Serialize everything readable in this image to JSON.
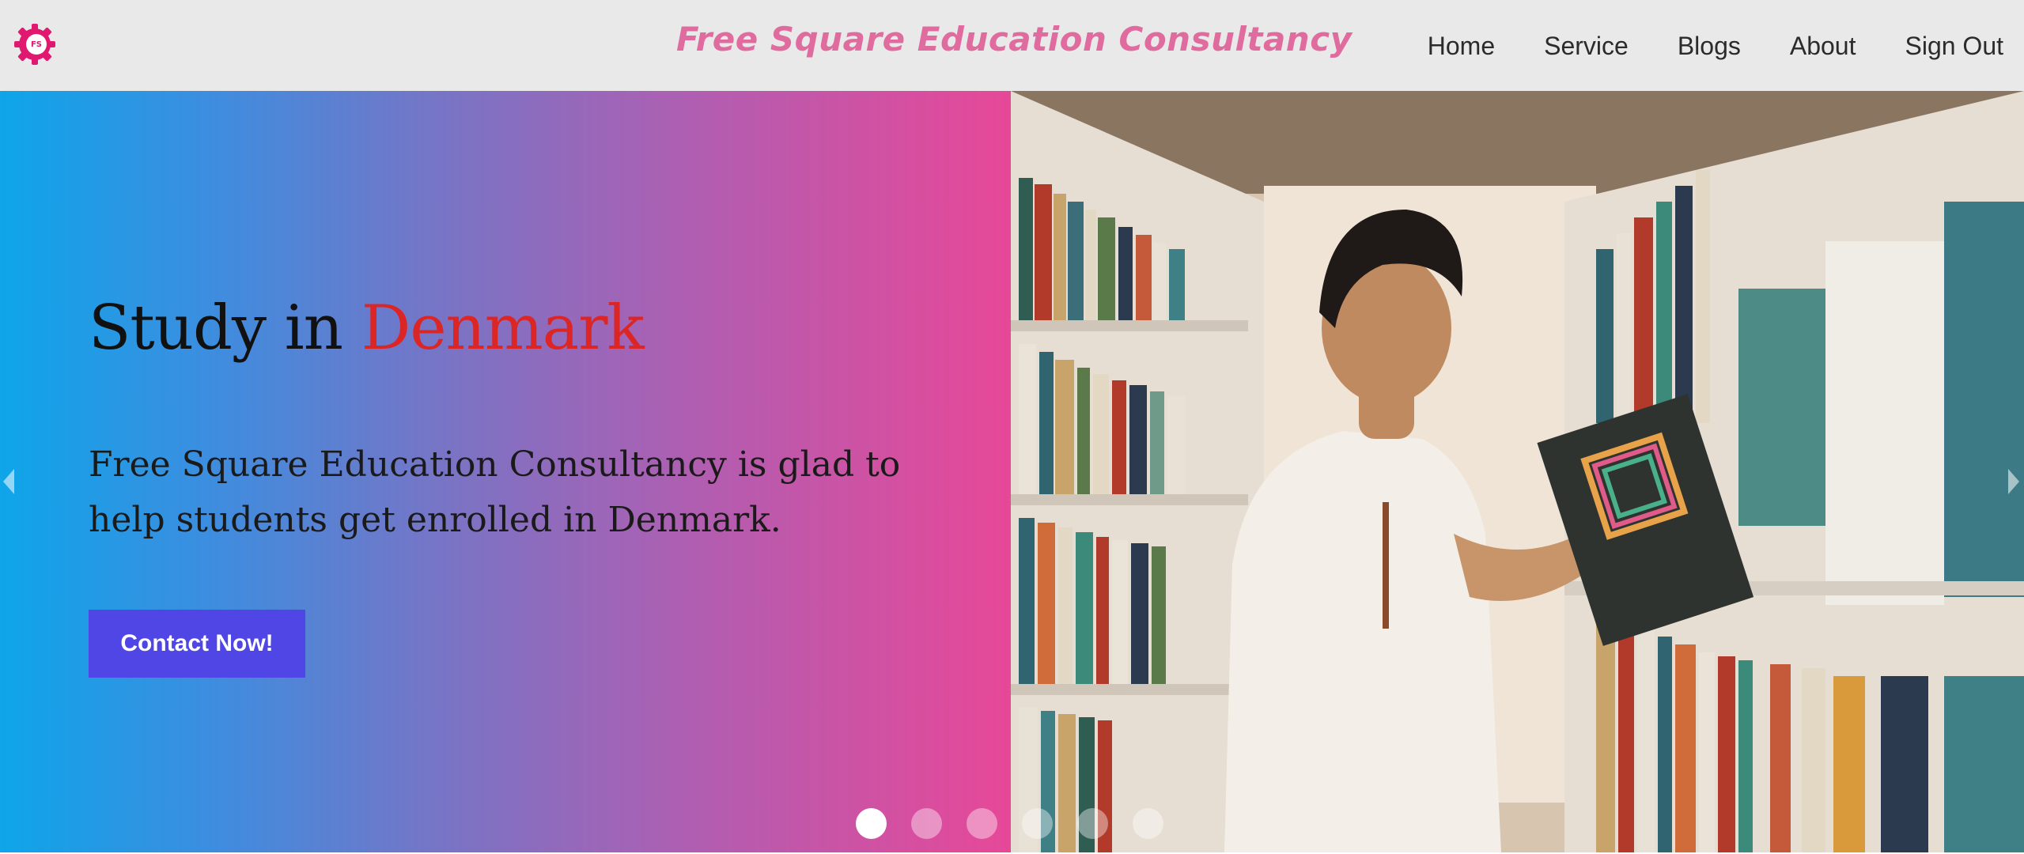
{
  "header": {
    "logo_text": "FS",
    "brand": "Free Square Education Consultancy",
    "nav": [
      {
        "label": "Home"
      },
      {
        "label": "Service"
      },
      {
        "label": "Blogs"
      },
      {
        "label": "About"
      },
      {
        "label": "Sign Out"
      }
    ]
  },
  "hero": {
    "title_prefix": "Study in",
    "title_country": "Denmark",
    "description": "Free Square Education Consultancy is glad to help students get enrolled in Denmark.",
    "cta_label": "Contact Now!",
    "image_description": "Student browsing a book on a library shelf",
    "carousel": {
      "slide_count": 6,
      "active_index": 0
    }
  },
  "colors": {
    "brand": "#e06c9f",
    "accent_red": "#dc2626",
    "cta": "#4f46e5",
    "gradient_start": "#0ea5e9",
    "gradient_end": "#e74898"
  }
}
